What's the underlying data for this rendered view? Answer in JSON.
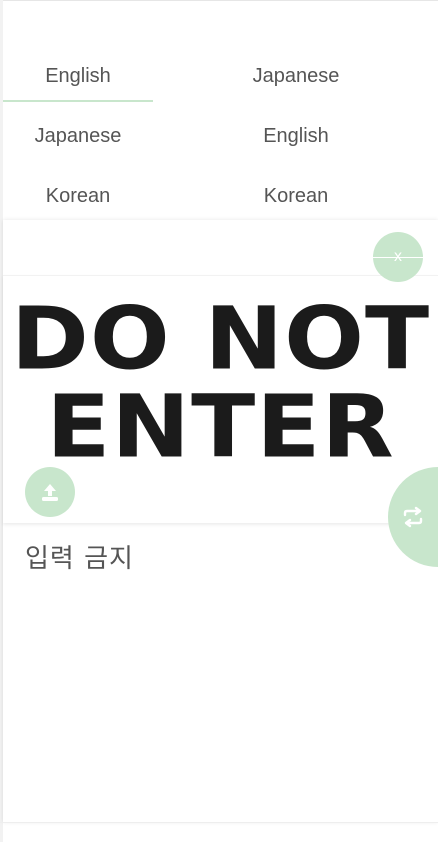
{
  "source_languages": [
    {
      "label": "English",
      "selected": true
    },
    {
      "label": "Japanese",
      "selected": false
    },
    {
      "label": "Korean",
      "selected": false
    }
  ],
  "target_languages": [
    {
      "label": "Japanese",
      "selected": false
    },
    {
      "label": "English",
      "selected": false
    },
    {
      "label": "Korean",
      "selected": true
    }
  ],
  "image_panel": {
    "sign_line1": "DO NOT",
    "sign_line2": "ENTER",
    "close_label": "x",
    "upload_icon": "upload-icon"
  },
  "result": {
    "translated_text": "입력 금지"
  },
  "swap_icon": "swap-icon",
  "colors": {
    "accent": "#c8e6cc",
    "text": "#555555",
    "sign_text": "#1b1b1b"
  }
}
